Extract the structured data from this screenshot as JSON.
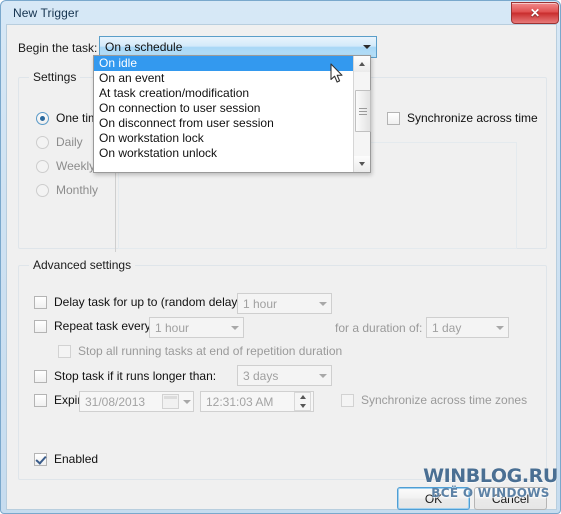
{
  "window": {
    "title": "New Trigger",
    "close_label": "✕"
  },
  "begin": {
    "label": "Begin the task:",
    "selected": "On a schedule",
    "options": [
      "On idle",
      "On an event",
      "At task creation/modification",
      "On connection to user session",
      "On disconnect from user session",
      "On workstation lock",
      "On workstation unlock"
    ],
    "highlighted": "On idle"
  },
  "settings": {
    "title": "Settings",
    "radios": [
      {
        "label": "One time",
        "checked": true,
        "disabled": false
      },
      {
        "label": "Daily",
        "checked": false,
        "disabled": true
      },
      {
        "label": "Weekly",
        "checked": false,
        "disabled": true
      },
      {
        "label": "Monthly",
        "checked": false,
        "disabled": true
      }
    ],
    "sync_checkbox": "Synchronize across time"
  },
  "advanced": {
    "title": "Advanced settings",
    "delay": {
      "label": "Delay task for up to (random delay):",
      "value": "1 hour",
      "checked": false
    },
    "repeat": {
      "label": "Repeat task every:",
      "value": "1 hour",
      "checked": false,
      "duration_label": "for a duration of:",
      "duration_value": "1 day"
    },
    "stop_repetition": {
      "label": "Stop all running tasks at end of repetition duration",
      "checked": false
    },
    "stop_longer": {
      "label": "Stop task if it runs longer than:",
      "value": "3 days",
      "checked": false
    },
    "expire": {
      "label": "Expire:",
      "date": "31/08/2013",
      "time": "12:31:03 AM",
      "checked": false
    },
    "sync_zones": {
      "label": "Synchronize across time zones",
      "checked": false
    },
    "enabled": {
      "label": "Enabled",
      "checked": true
    }
  },
  "buttons": {
    "ok": "OK",
    "cancel": "Cancel"
  },
  "watermark": {
    "line1": "WINBLOG.RU",
    "line2": "ВСЁ О WINDOWS"
  }
}
